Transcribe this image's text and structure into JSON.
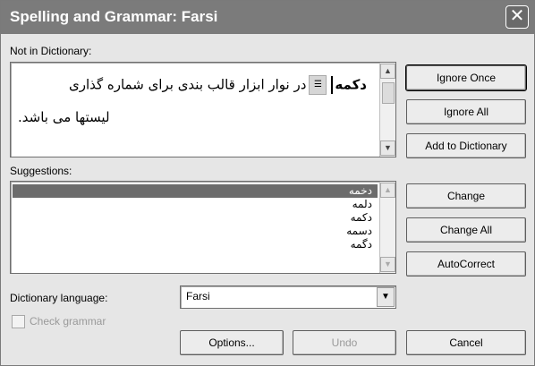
{
  "window": {
    "title": "Spelling and Grammar: Farsi",
    "close_glyph": "✕"
  },
  "not_in_dictionary": {
    "label": "Not in Dictionary:",
    "line1_word": "دکمه",
    "line1_rest": "در نوار ابزار قالب بندی برای شماره گذاری",
    "line2": "لیستها می باشد."
  },
  "buttons": {
    "ignore_once": "Ignore Once",
    "ignore_all": "Ignore All",
    "add_to_dictionary": "Add to Dictionary",
    "change": "Change",
    "change_all": "Change All",
    "autocorrect": "AutoCorrect",
    "options": "Options...",
    "undo": "Undo",
    "cancel": "Cancel"
  },
  "suggestions": {
    "label": "Suggestions:",
    "items": [
      "دخمه",
      "دلمه",
      "دکمه",
      "دسمه",
      "دگمه"
    ],
    "selected_index": 0
  },
  "dictionary_language": {
    "label": "Dictionary language:",
    "value": "Farsi"
  },
  "check_grammar": {
    "label": "Check grammar",
    "checked": false,
    "enabled": false
  },
  "colors": {
    "titlebar": "#7b7b7b",
    "selection": "#6c6c6c"
  }
}
